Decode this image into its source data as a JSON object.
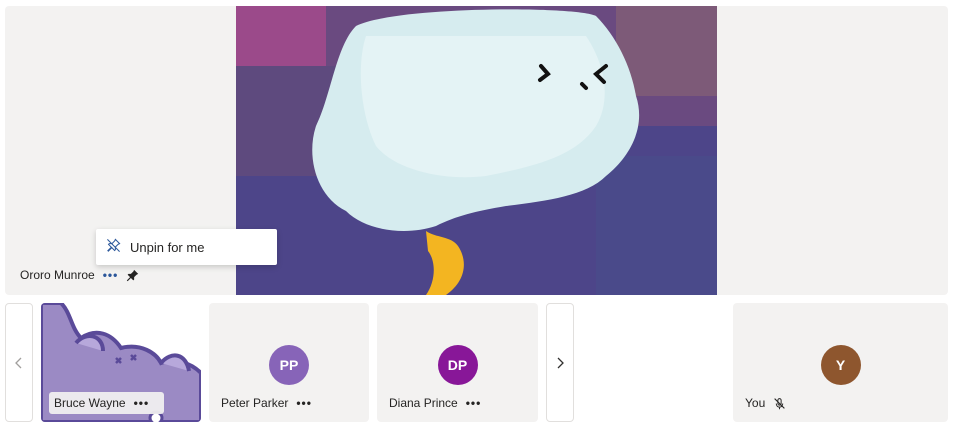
{
  "main_stage": {
    "participant_name": "Ororo Munroe",
    "more_label": "•••"
  },
  "context_menu": {
    "unpin_label": "Unpin for me"
  },
  "gallery": {
    "tiles": [
      {
        "name": "Bruce Wayne",
        "more_label": "•••"
      },
      {
        "name": "Peter Parker",
        "initials": "PP",
        "avatar_color": "#8764b8",
        "more_label": "•••"
      },
      {
        "name": "Diana Prince",
        "initials": "DP",
        "avatar_color": "#881798",
        "more_label": "•••"
      }
    ],
    "self_tile": {
      "name": "You",
      "initials": "Y",
      "avatar_color": "#8e562e"
    }
  },
  "colors": {
    "stage_bg": "#f3f2f1",
    "accent": "#2b579a"
  },
  "icons": {
    "pin": "pin-icon",
    "unpin": "unpin-icon",
    "mic_off": "mic-off-icon",
    "prev": "chevron-left-icon",
    "next": "chevron-right-icon"
  }
}
